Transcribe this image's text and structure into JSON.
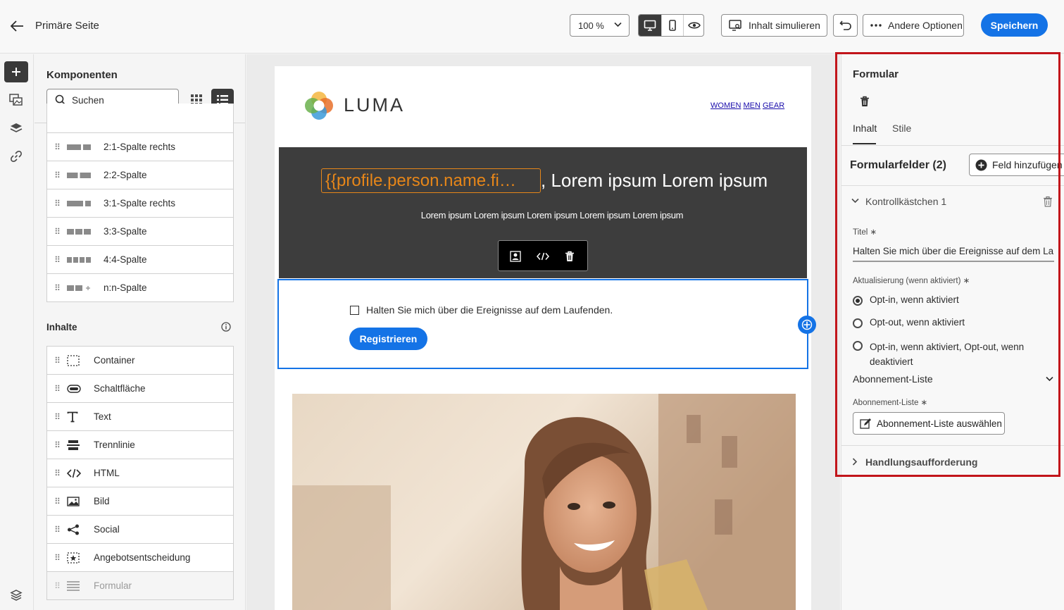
{
  "header": {
    "title": "Primäre Seite",
    "zoom": "100 %",
    "simulate_label": "Inhalt simulieren",
    "more_options_label": "Andere Optionen",
    "save_label": "Speichern"
  },
  "components_panel": {
    "title": "Komponenten",
    "search_placeholder": "Suchen",
    "structures": [
      {
        "label": "2:1-Spalte rechts"
      },
      {
        "label": "2:2-Spalte"
      },
      {
        "label": "3:1-Spalte rechts"
      },
      {
        "label": "3:3-Spalte"
      },
      {
        "label": "4:4-Spalte"
      },
      {
        "label": "n:n-Spalte"
      }
    ],
    "contents_title": "Inhalte",
    "contents": [
      {
        "label": "Container"
      },
      {
        "label": "Schaltfläche"
      },
      {
        "label": "Text"
      },
      {
        "label": "Trennlinie"
      },
      {
        "label": "HTML"
      },
      {
        "label": "Bild"
      },
      {
        "label": "Social"
      },
      {
        "label": "Angebotsentscheidung"
      },
      {
        "label": "Formular"
      }
    ]
  },
  "email": {
    "logo_text": "LUMA",
    "nav": {
      "women": "WOMEN",
      "men": "MEN",
      "gear": "GEAR"
    },
    "hero_token": "{{profile.person.name.fi…",
    "hero_title": ", Lorem ipsum Lorem ipsum",
    "hero_body": "Lorem ipsum Lorem ipsum Lorem ipsum Lorem ipsum Lorem ipsum",
    "form_checkbox_label": "Halten Sie mich über die Ereignisse auf dem Laufenden.",
    "form_button": "Registrieren"
  },
  "properties": {
    "title": "Formular",
    "tab_content": "Inhalt",
    "tab_styles": "Stile",
    "fields_title": "Formularfelder (2)",
    "add_field_label": "Feld hinzufügen",
    "section_title": "Kontrollkästchen 1",
    "title_label": "Titel",
    "title_value": "Halten Sie mich über die Ereignisse auf dem Lau...",
    "update_label": "Aktualisierung (wenn aktiviert)",
    "options": [
      {
        "label": "Opt-in, wenn aktiviert",
        "selected": true
      },
      {
        "label": "Opt-out, wenn aktiviert",
        "selected": false
      },
      {
        "label": "Opt-in, wenn aktiviert, Opt-out, wenn deaktiviert",
        "selected": false
      }
    ],
    "subscription_header": "Abonnement-Liste",
    "subscription_label": "Abonnement-Liste",
    "subscription_button": "Abonnement-Liste auswählen",
    "cta_title": "Handlungsaufforderung"
  },
  "colors": {
    "accent_blue": "#1473e6",
    "highlight_red": "#c2151b",
    "hero_bg": "#3d3d3d",
    "token_orange": "#e68619"
  }
}
